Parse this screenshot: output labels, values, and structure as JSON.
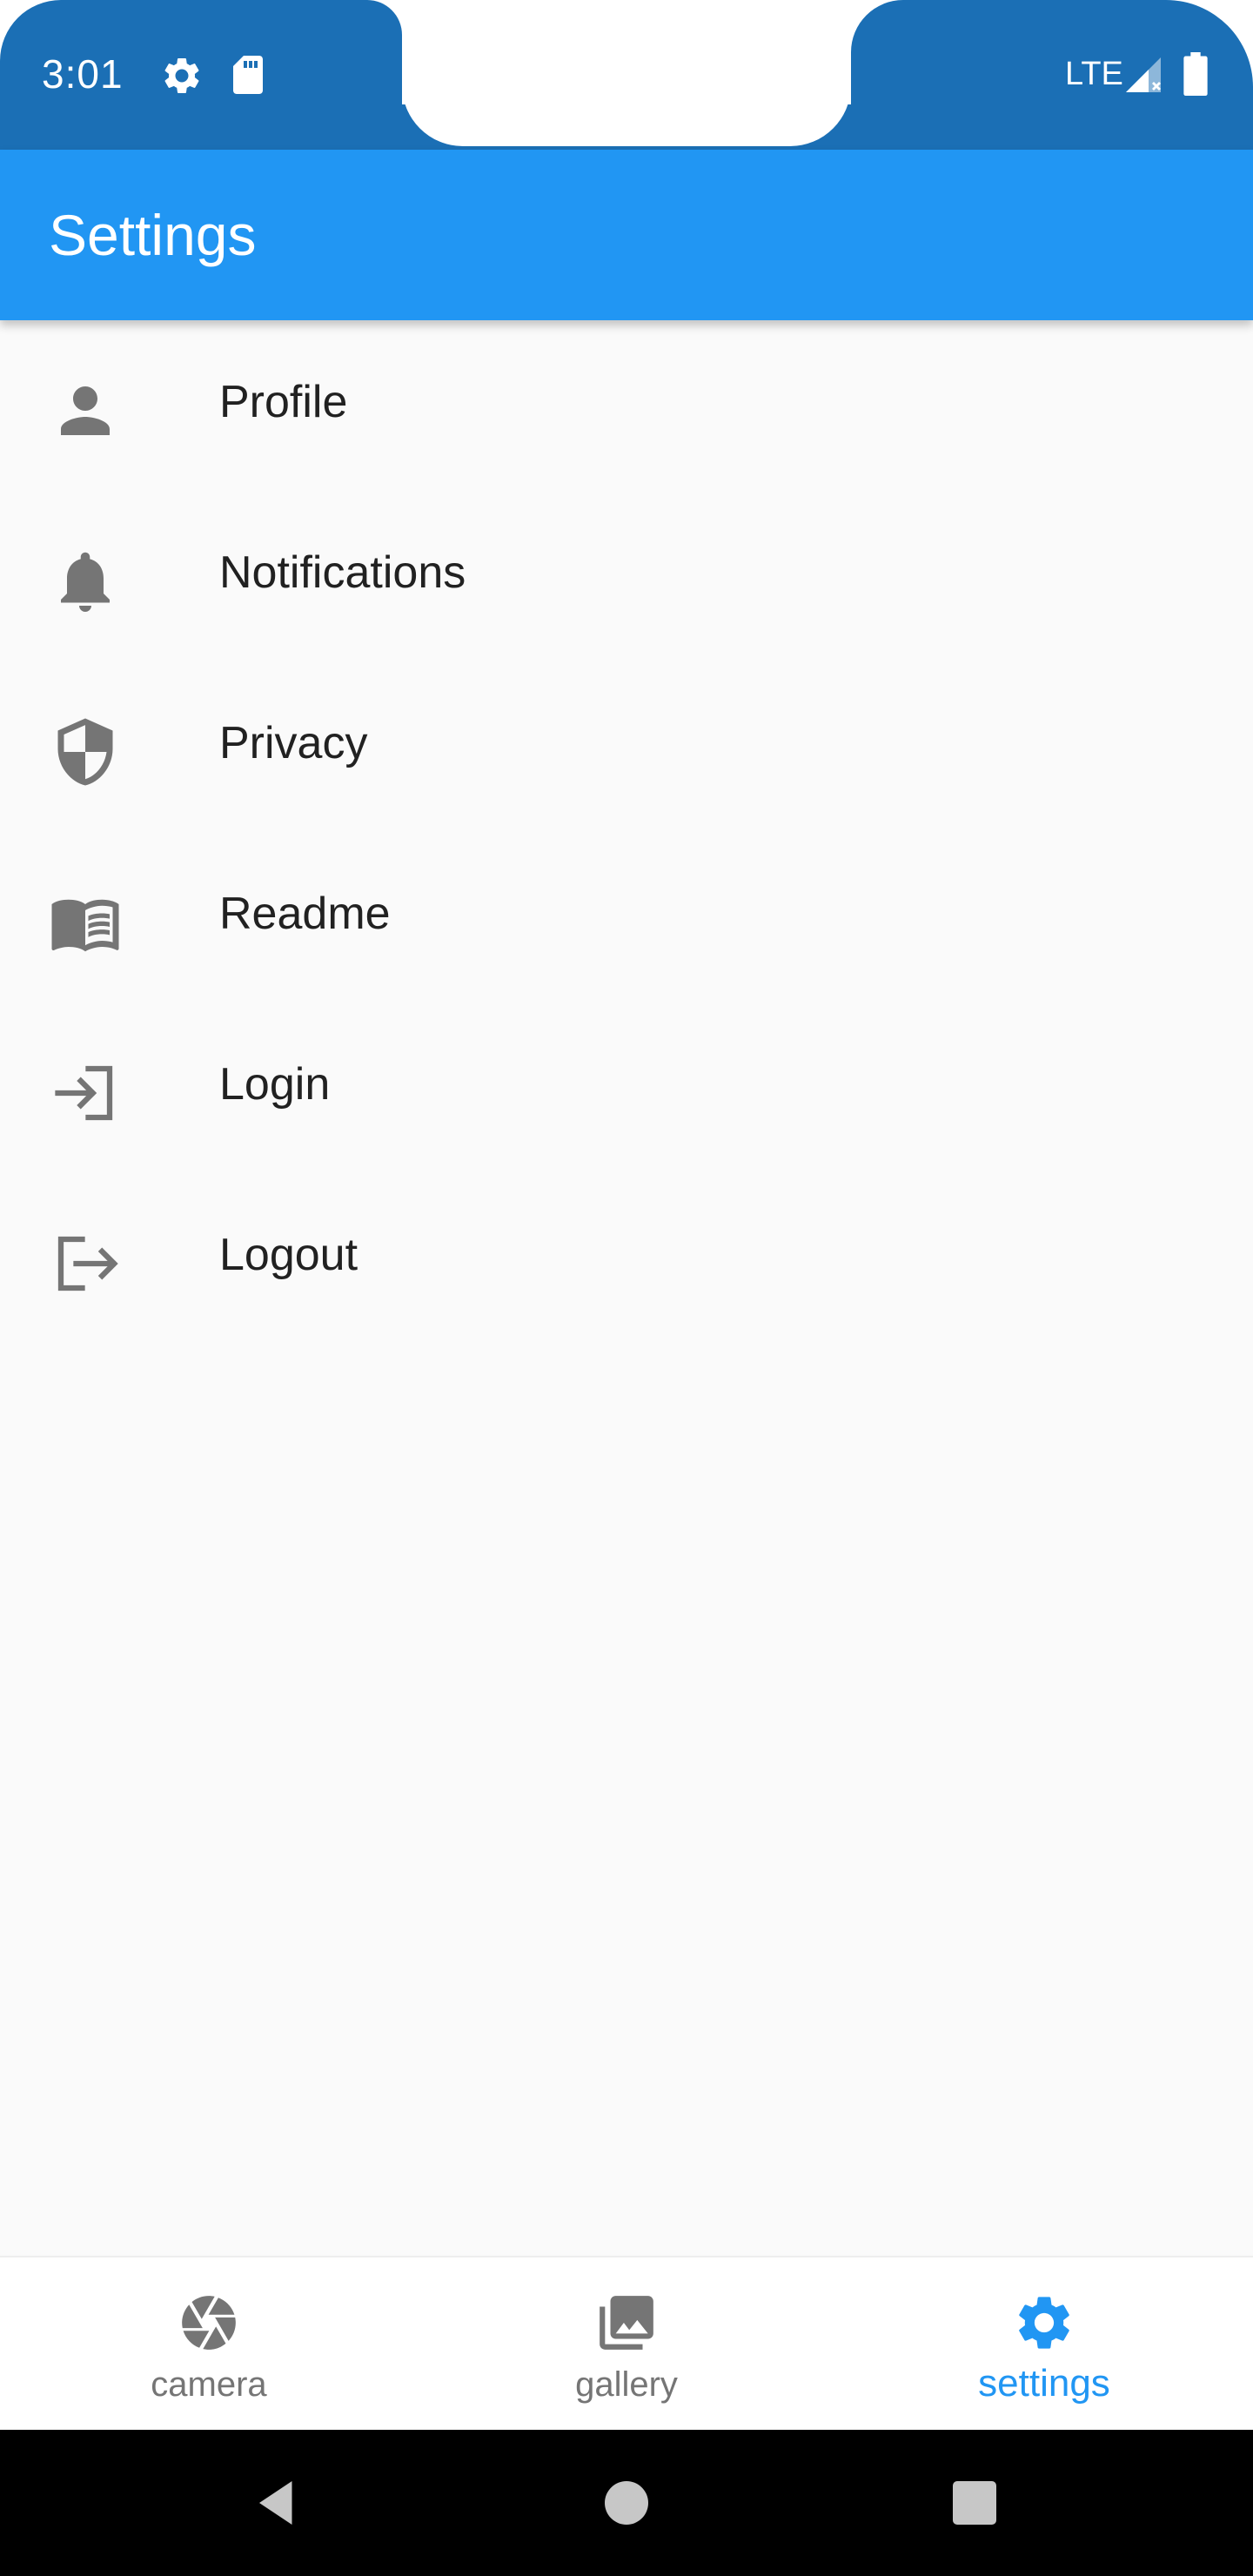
{
  "status_bar": {
    "time": "3:01",
    "network": "LTE",
    "icons": [
      "gear-icon",
      "sd-card-icon",
      "signal-icon",
      "battery-icon"
    ]
  },
  "app_bar": {
    "title": "Settings"
  },
  "settings": {
    "items": [
      {
        "label": "Profile",
        "icon": "person-icon"
      },
      {
        "label": "Notifications",
        "icon": "bell-icon"
      },
      {
        "label": "Privacy",
        "icon": "shield-icon"
      },
      {
        "label": "Readme",
        "icon": "book-icon"
      },
      {
        "label": "Login",
        "icon": "login-icon"
      },
      {
        "label": "Logout",
        "icon": "logout-icon"
      }
    ]
  },
  "bottom_nav": {
    "items": [
      {
        "label": "camera",
        "icon": "camera-shutter-icon",
        "active": false
      },
      {
        "label": "gallery",
        "icon": "gallery-icon",
        "active": false
      },
      {
        "label": "settings",
        "icon": "gear-icon",
        "active": true
      }
    ]
  },
  "colors": {
    "status_bar": "#1b6fb5",
    "app_bar": "#2196f3",
    "accent": "#2196f3",
    "icon_grey": "#757575",
    "background": "#fafafa",
    "text": "#212121"
  }
}
